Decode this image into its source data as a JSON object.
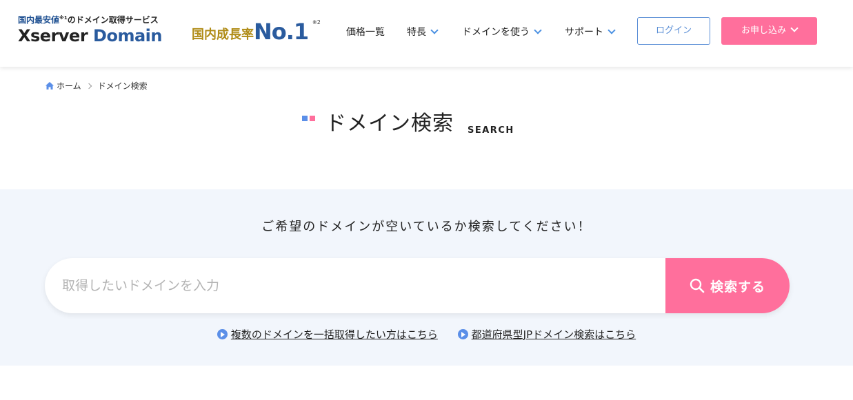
{
  "header": {
    "logo_tag_blue": "国内最安値",
    "logo_tag_sup": "※1",
    "logo_tag_rest": "のドメイン取得サービス",
    "logo_brand_x": "Xserver",
    "logo_brand_d": "Domain",
    "badge_text": "国内成長率",
    "badge_no": "No.1",
    "badge_sup": "※2",
    "nav": [
      {
        "label": "価格一覧",
        "dropdown": false
      },
      {
        "label": "特長",
        "dropdown": true
      },
      {
        "label": "ドメインを使う",
        "dropdown": true
      },
      {
        "label": "サポート",
        "dropdown": true
      }
    ],
    "login_label": "ログイン",
    "apply_label": "お申し込み"
  },
  "breadcrumb": {
    "home": "ホーム",
    "current": "ドメイン検索"
  },
  "title": {
    "main": "ドメイン検索",
    "sub": "SEARCH"
  },
  "search": {
    "lead": "ご希望のドメインが空いているか検索してください！",
    "placeholder": "取得したいドメインを入力",
    "button_label": "検索する",
    "links": [
      "複数のドメインを一括取得したい方はこちら",
      "都道府県型JPドメイン検索はこちら"
    ]
  },
  "colors": {
    "accent_blue": "#5b8fe8",
    "accent_pink": "#ff6f9c",
    "section_bg": "#f2f6fc"
  }
}
